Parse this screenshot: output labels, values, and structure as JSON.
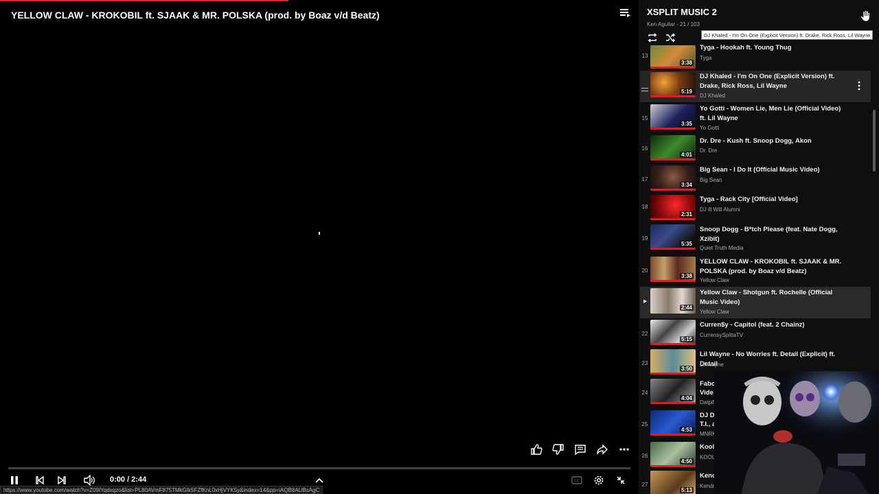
{
  "player": {
    "title": "YELLOW CLAW - KROKOBIL ft. SJAAK & MR. POLSKA (prod. by Boaz v/d Beatz)",
    "time": "0:00 / 2:44",
    "status_url": "https://www.youtube.com/watch?v=Z09IYqdxqzo&list=PL80AVmF875TMkGIk5FZfKnL0xHjVYK5y&index=14&pp=iAQB8AUBsAgC"
  },
  "playlist": {
    "title": "XSPLIT MUSIC 2",
    "subtitle": "Ken Aguilar - 21 / 103",
    "tooltip": "DJ Khaled - I'm On One (Explicit Version) ft. Drake, Rick Ross, Lil Wayne",
    "items": [
      {
        "index": "13",
        "title": "Tyga - Hookah ft. Young Thug",
        "channel": "Tyga",
        "duration": "3:38"
      },
      {
        "index": "",
        "title": "DJ Khaled - I'm On One (Explicit Version) ft. Drake, Rick Ross, Lil Wayne",
        "channel": "DJ Khaled",
        "duration": "5:19"
      },
      {
        "index": "15",
        "title": "Yo Gotti - Women Lie, Men Lie (Official Video) ft. Lil Wayne",
        "channel": "Yo Gotti",
        "duration": "3:35"
      },
      {
        "index": "16",
        "title": "Dr. Dre - Kush ft. Snoop Dogg, Akon",
        "channel": "Dr. Dre",
        "duration": "4:01"
      },
      {
        "index": "17",
        "title": "Big Sean - I Do It (Official Music Video)",
        "channel": "Big Sean",
        "duration": "3:34"
      },
      {
        "index": "18",
        "title": "Tyga - Rack City [Official Video]",
        "channel": "DJ ill Will Alumni",
        "duration": "2:31"
      },
      {
        "index": "19",
        "title": "Snoop Dogg - B*tch Please (feat. Nate Dogg, Xzibit)",
        "channel": "Quiet Truth Media",
        "duration": "5:35"
      },
      {
        "index": "20",
        "title": "YELLOW CLAW - KROKOBIL ft. SJAAK & MR. POLSKA (prod. by Boaz v/d Beatz)",
        "channel": "Yellow Claw",
        "duration": "3:38"
      },
      {
        "index": "",
        "title": "Yellow Claw - Shotgun ft. Rochelle (Official Music Video)",
        "channel": "Yellow Claw",
        "duration": "2:44"
      },
      {
        "index": "22",
        "title": "Curren$y - Capitol (feat. 2 Chainz)",
        "channel": "CurrensySpittaTV",
        "duration": "5:15"
      },
      {
        "index": "23",
        "title": "Lil Wayne - No Worries ft. Detail (Explicit) ft. Detail",
        "channel": "Lil Wayne",
        "duration": "3:50"
      },
      {
        "index": "24",
        "title": "Fabo",
        "title2": "Vide",
        "channel": "Datpif",
        "duration": "4:04"
      },
      {
        "index": "25",
        "title": "DJ D",
        "title2": "T.I., a",
        "channel": "MNRK",
        "duration": "4:53"
      },
      {
        "index": "26",
        "title": "Kool",
        "channel": "KOOL",
        "duration": "4:50"
      },
      {
        "index": "27",
        "title": "Kend",
        "channel": "Kendr",
        "duration": "5:13"
      }
    ]
  },
  "colors": {
    "accent": "#e01b24",
    "bg": "#0f0f0f",
    "active_row": "#2b2a29"
  }
}
